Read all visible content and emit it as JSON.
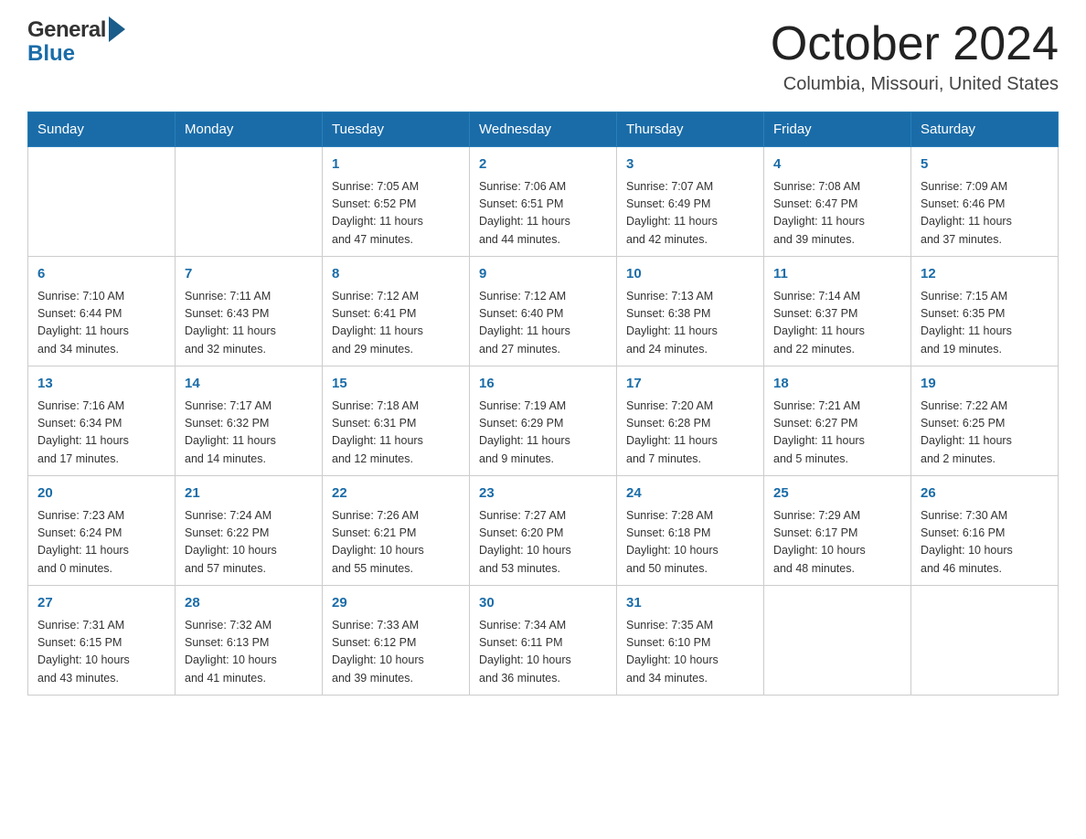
{
  "header": {
    "title": "October 2024",
    "subtitle": "Columbia, Missouri, United States",
    "logo_general": "General",
    "logo_blue": "Blue"
  },
  "days_of_week": [
    "Sunday",
    "Monday",
    "Tuesday",
    "Wednesday",
    "Thursday",
    "Friday",
    "Saturday"
  ],
  "weeks": [
    [
      {
        "day": "",
        "content": ""
      },
      {
        "day": "",
        "content": ""
      },
      {
        "day": "1",
        "content": "Sunrise: 7:05 AM\nSunset: 6:52 PM\nDaylight: 11 hours\nand 47 minutes."
      },
      {
        "day": "2",
        "content": "Sunrise: 7:06 AM\nSunset: 6:51 PM\nDaylight: 11 hours\nand 44 minutes."
      },
      {
        "day": "3",
        "content": "Sunrise: 7:07 AM\nSunset: 6:49 PM\nDaylight: 11 hours\nand 42 minutes."
      },
      {
        "day": "4",
        "content": "Sunrise: 7:08 AM\nSunset: 6:47 PM\nDaylight: 11 hours\nand 39 minutes."
      },
      {
        "day": "5",
        "content": "Sunrise: 7:09 AM\nSunset: 6:46 PM\nDaylight: 11 hours\nand 37 minutes."
      }
    ],
    [
      {
        "day": "6",
        "content": "Sunrise: 7:10 AM\nSunset: 6:44 PM\nDaylight: 11 hours\nand 34 minutes."
      },
      {
        "day": "7",
        "content": "Sunrise: 7:11 AM\nSunset: 6:43 PM\nDaylight: 11 hours\nand 32 minutes."
      },
      {
        "day": "8",
        "content": "Sunrise: 7:12 AM\nSunset: 6:41 PM\nDaylight: 11 hours\nand 29 minutes."
      },
      {
        "day": "9",
        "content": "Sunrise: 7:12 AM\nSunset: 6:40 PM\nDaylight: 11 hours\nand 27 minutes."
      },
      {
        "day": "10",
        "content": "Sunrise: 7:13 AM\nSunset: 6:38 PM\nDaylight: 11 hours\nand 24 minutes."
      },
      {
        "day": "11",
        "content": "Sunrise: 7:14 AM\nSunset: 6:37 PM\nDaylight: 11 hours\nand 22 minutes."
      },
      {
        "day": "12",
        "content": "Sunrise: 7:15 AM\nSunset: 6:35 PM\nDaylight: 11 hours\nand 19 minutes."
      }
    ],
    [
      {
        "day": "13",
        "content": "Sunrise: 7:16 AM\nSunset: 6:34 PM\nDaylight: 11 hours\nand 17 minutes."
      },
      {
        "day": "14",
        "content": "Sunrise: 7:17 AM\nSunset: 6:32 PM\nDaylight: 11 hours\nand 14 minutes."
      },
      {
        "day": "15",
        "content": "Sunrise: 7:18 AM\nSunset: 6:31 PM\nDaylight: 11 hours\nand 12 minutes."
      },
      {
        "day": "16",
        "content": "Sunrise: 7:19 AM\nSunset: 6:29 PM\nDaylight: 11 hours\nand 9 minutes."
      },
      {
        "day": "17",
        "content": "Sunrise: 7:20 AM\nSunset: 6:28 PM\nDaylight: 11 hours\nand 7 minutes."
      },
      {
        "day": "18",
        "content": "Sunrise: 7:21 AM\nSunset: 6:27 PM\nDaylight: 11 hours\nand 5 minutes."
      },
      {
        "day": "19",
        "content": "Sunrise: 7:22 AM\nSunset: 6:25 PM\nDaylight: 11 hours\nand 2 minutes."
      }
    ],
    [
      {
        "day": "20",
        "content": "Sunrise: 7:23 AM\nSunset: 6:24 PM\nDaylight: 11 hours\nand 0 minutes."
      },
      {
        "day": "21",
        "content": "Sunrise: 7:24 AM\nSunset: 6:22 PM\nDaylight: 10 hours\nand 57 minutes."
      },
      {
        "day": "22",
        "content": "Sunrise: 7:26 AM\nSunset: 6:21 PM\nDaylight: 10 hours\nand 55 minutes."
      },
      {
        "day": "23",
        "content": "Sunrise: 7:27 AM\nSunset: 6:20 PM\nDaylight: 10 hours\nand 53 minutes."
      },
      {
        "day": "24",
        "content": "Sunrise: 7:28 AM\nSunset: 6:18 PM\nDaylight: 10 hours\nand 50 minutes."
      },
      {
        "day": "25",
        "content": "Sunrise: 7:29 AM\nSunset: 6:17 PM\nDaylight: 10 hours\nand 48 minutes."
      },
      {
        "day": "26",
        "content": "Sunrise: 7:30 AM\nSunset: 6:16 PM\nDaylight: 10 hours\nand 46 minutes."
      }
    ],
    [
      {
        "day": "27",
        "content": "Sunrise: 7:31 AM\nSunset: 6:15 PM\nDaylight: 10 hours\nand 43 minutes."
      },
      {
        "day": "28",
        "content": "Sunrise: 7:32 AM\nSunset: 6:13 PM\nDaylight: 10 hours\nand 41 minutes."
      },
      {
        "day": "29",
        "content": "Sunrise: 7:33 AM\nSunset: 6:12 PM\nDaylight: 10 hours\nand 39 minutes."
      },
      {
        "day": "30",
        "content": "Sunrise: 7:34 AM\nSunset: 6:11 PM\nDaylight: 10 hours\nand 36 minutes."
      },
      {
        "day": "31",
        "content": "Sunrise: 7:35 AM\nSunset: 6:10 PM\nDaylight: 10 hours\nand 34 minutes."
      },
      {
        "day": "",
        "content": ""
      },
      {
        "day": "",
        "content": ""
      }
    ]
  ]
}
